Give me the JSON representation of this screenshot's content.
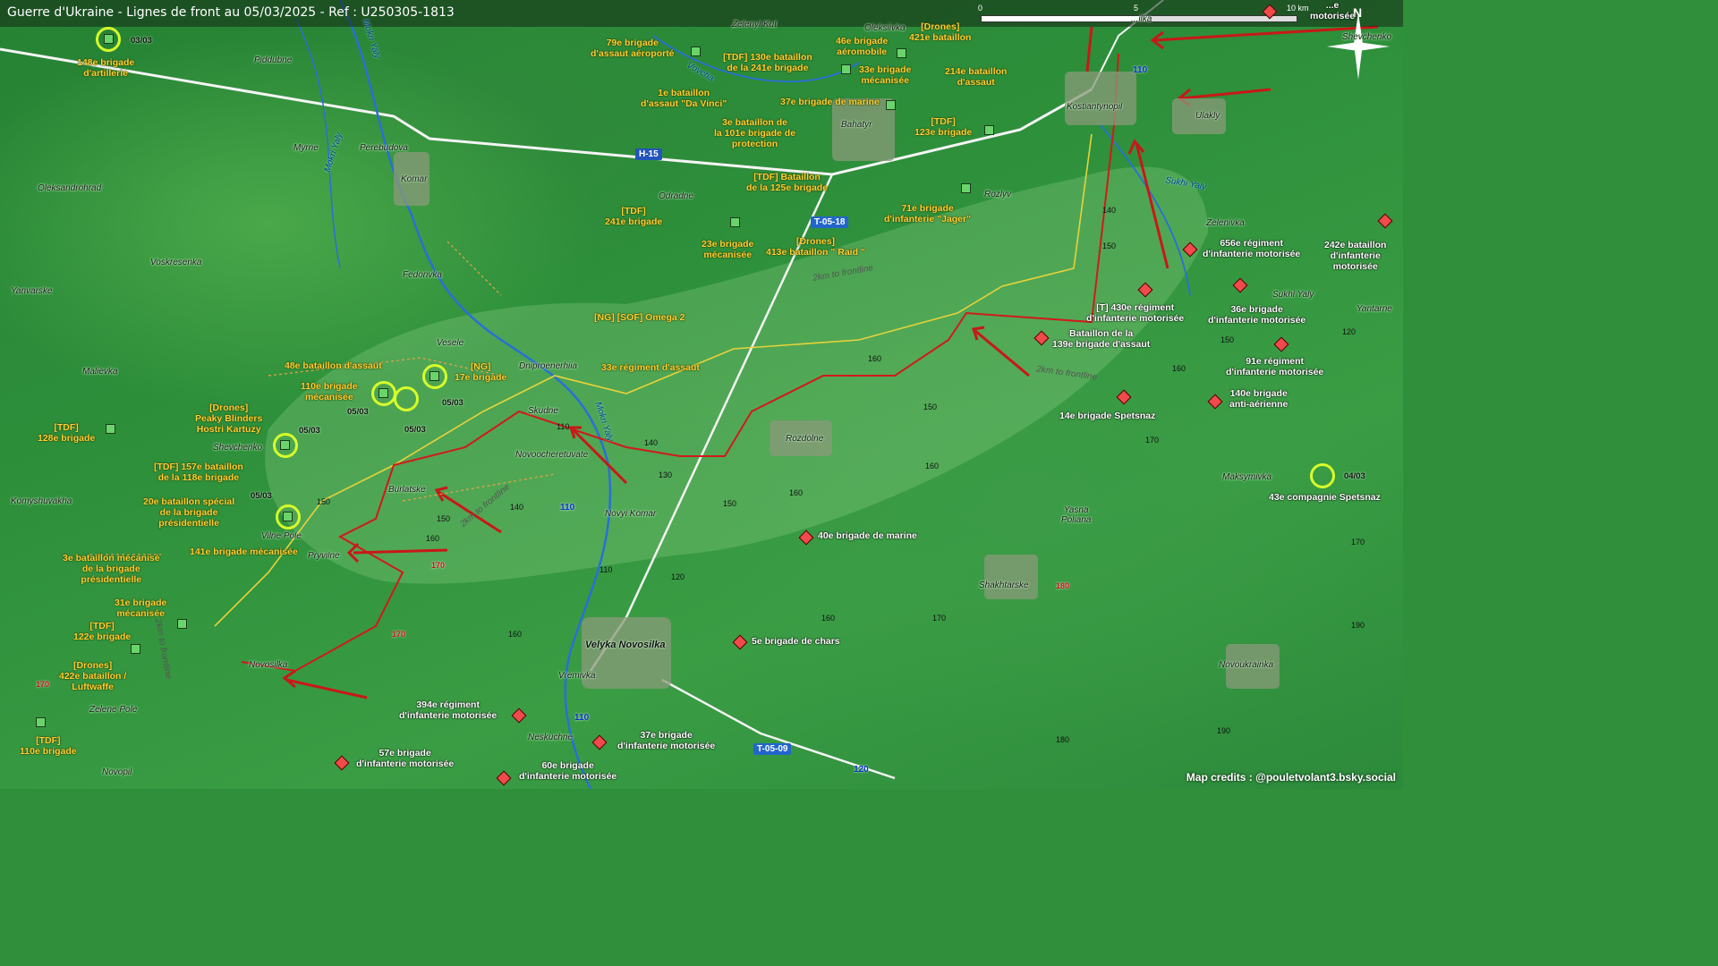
{
  "title": "Guerre d'Ukraine - Lignes de front au 05/03/2025 - Ref : U250305-1813",
  "scale": {
    "labels": [
      "0",
      "5",
      "10 km"
    ]
  },
  "north_label": "N",
  "credits": "Map credits : @pouletvolant3.bsky.social",
  "colors": {
    "ukr_unit_text": "#ffcf33",
    "rus_unit_text": "#ffffff",
    "frontline": "#d11a1a",
    "grey_zone": "#e8d23a",
    "ukr_symbol": "#6ad46a",
    "rus_symbol": "#f04a4a",
    "highlight_ring": "#d8ff2a"
  },
  "roads": {
    "h15": "H-15",
    "t0518": "T-05-18",
    "t0509": "T-05-09",
    "r110a": "110",
    "r110b": "110",
    "r110c": "110",
    "r120": "120"
  },
  "places": {
    "piddubne": "Piddubne",
    "myrne": "Myrne",
    "perebudova": "Perebudova",
    "komar": "Komar",
    "oleksandrohrad": "Oleksandrohrad",
    "voskresenka": "Voskresenka",
    "yanvarske": "Yanvarske",
    "fedorivka": "Fedorivka",
    "vesele": "Vesele",
    "malievka": "Malievka",
    "dniproenerhiia": "Dniproenerhiia",
    "skudne": "Skudne",
    "novoocheretuvate": "Novoocheretuvate",
    "shevchenko_w": "Shevchenko",
    "burlatske": "Burlatske",
    "komyshuvakha": "Komyshuvakha",
    "vilne_pole": "Vilne Pole",
    "pryvilne": "Pryvilne",
    "novyi_komar": "Novyi Komar",
    "novosilka": "Novosilka",
    "zelene_pole": "Zelene Pole",
    "novopil": "Novopil",
    "velyka_novosilka": "Velyka Novosilka",
    "vremivka": "Vremivka",
    "neskuchne": "Neskuchne",
    "odradne": "Odradne",
    "bahatyr": "Bahatyr",
    "zelenyi_kut": "Zelenyi Kut",
    "oleksiivka": "Oleksiivka",
    "kostiantynopil": "Kostiantynopil",
    "ulakly": "Ulakly",
    "rozlyv": "Rozlyv",
    "rozdolne": "Rozdolne",
    "zelenivka": "Zelenivka",
    "yantarne": "Yantarne",
    "sukhi_yaly_town": "Sukhi Yaly",
    "maksymivka": "Maksymivka",
    "yasna_poliana": "Yasna\nPoliana",
    "shakhtarske": "Shakhtarske",
    "novoukrainka": "Novoukrainka",
    "shevchenko_e": "Shevchenko",
    "vilka": "...ilka"
  },
  "rivers": {
    "mokri_yaly_n": "Mokri Yaly",
    "mokri_yaly_c": "Mokri Yaly",
    "mokri_yaly_w": "Mokri Yaly",
    "vovcha": "Vovcha",
    "sukhi_yaly": "Sukhi Yaly"
  },
  "front_labels": {
    "a": "2km to frontline",
    "b": "2km to frontline",
    "c": "2km to frontline",
    "d": "2km to frontline"
  },
  "altitudes": {
    "a140": "140",
    "a150": "150",
    "a160a": "160",
    "a150b": "150",
    "a170": "170",
    "a120": "120",
    "a160b": "160",
    "a160c": "160",
    "a150c": "150",
    "a140b": "140",
    "a130": "130",
    "a150d": "150",
    "a110": "110",
    "a110b": "110",
    "a140c": "140",
    "a150e": "150",
    "a160d": "160",
    "a120b": "120",
    "a160e": "160",
    "a170b": "170",
    "a160f": "160",
    "a170c": "170",
    "a190": "190",
    "a180": "180",
    "a190b": "190",
    "a150f": "150",
    "a160g": "160"
  },
  "red_altitudes": {
    "r170a": "170",
    "r170b": "170",
    "r170c": "170",
    "r180": "180"
  },
  "dates": {
    "d1": "03/03",
    "d2": "05/03",
    "d3": "05/03",
    "d4": "05/03",
    "d5": "05/03",
    "d6": "05/03",
    "d7": "04/03"
  },
  "ukr_units": {
    "u148": "148e brigade\nd'artillerie",
    "u79": "79e brigade\nd'assaut aéroporté",
    "u130": "[TDF] 130e bataillon\nde la 241e brigade",
    "u46": "46e brigade\naéromobile",
    "u421": "[Drones]\n421e bataillon",
    "u33": "33e brigade\nmécanisée",
    "u214": "214e bataillon\nd'assaut",
    "u1davinci": "1e bataillon\nd'assaut \"Da Vinci\"",
    "u37m": "37e brigade de marine",
    "u3bat101": "3e bataillon de\nla 101e brigade de\nprotection",
    "u123": "[TDF]\n123e brigade",
    "u125": "[TDF] Bataillon\nde la 125e brigade",
    "u241": "[TDF]\n241e brigade",
    "u23": "23e brigade\nmécanisée",
    "u413": "[Drones]\n413e bataillon \" Raid \"",
    "u71": "71e brigade\nd'infanterie \"Jager\"",
    "uomega": "[NG] [SOF] Omega 2",
    "u33r": "33e régiment d'assaut",
    "u48": "48e bataillon d'assaut",
    "u17": "[NG]\n17e brigade",
    "u110": "110e brigade\nmécanisée",
    "upeaky": "[Drones]\nPeaky Blinders\nHostri Kartuzy",
    "u128": "[TDF]\n128e brigade",
    "u157": "[TDF] 157e bataillon\nde la 118e brigade",
    "u20": "20e bataillon spécial\nde la brigade\nprésidentielle",
    "u141": "141e brigade mécanisée",
    "u3pres": "3e bataillon mécanisé\nde la brigade\nprésidentielle",
    "u31": "31e brigade\nmécanisée",
    "u122": "[TDF]\n122e brigade",
    "u422": "[Drones]\n422e bataillon /\nLuftwaffe",
    "u110b": "[TDF]\n110e brigade"
  },
  "rus_units": {
    "r430": "[T] 430e régiment\nd'infanterie motorisée",
    "r139": "Bataillon de la\n139e brigade d'assaut",
    "r656": "656e régiment\nd'infanterie motorisée",
    "r242": "242e bataillon\nd'infanterie\nmotorisée",
    "r36": "36e brigade\nd'infanterie motorisée",
    "r91": "91e régiment\nd'infanterie motorisée",
    "r14": "14e brigade Spetsnaz",
    "r140": "140e brigade\nanti-aérienne",
    "r43": "43e compagnie Spetsnaz",
    "r40": "40e brigade de marine",
    "r5": "5e brigade de chars",
    "r394": "394e régiment\nd'infanterie motorisée",
    "r37": "37e brigade\nd'infanterie motorisée",
    "r57": "57e brigade\nd'infanterie motorisée",
    "r60": "60e brigade\nd'infanterie motorisée",
    "rtop": "...e\nmotorisée"
  }
}
